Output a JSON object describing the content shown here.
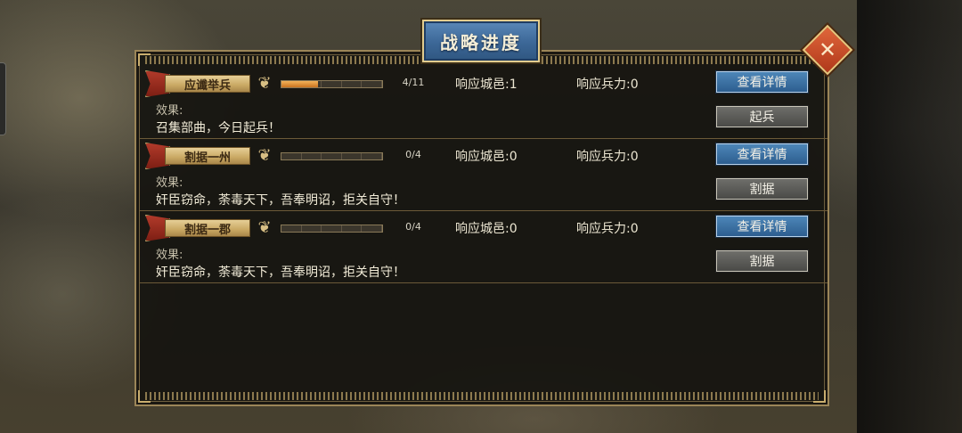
{
  "dialog": {
    "title": "战略进度",
    "close_label": "✕"
  },
  "rows": [
    {
      "name": "应谶举兵",
      "progress_current": 4,
      "progress_total": 11,
      "progress_text": "4/11",
      "cities": "响应城邑:1",
      "troops": "响应兵力:0",
      "effect_label": "效果:",
      "effect_text": "召集部曲，今日起兵！",
      "detail_label": "查看详情",
      "action_label": "起兵"
    },
    {
      "name": "割据一州",
      "progress_current": 0,
      "progress_total": 4,
      "progress_text": "0/4",
      "cities": "响应城邑:0",
      "troops": "响应兵力:0",
      "effect_label": "效果:",
      "effect_text": "奸臣窃命，荼毒天下，吾奉明诏，拒关自守！",
      "detail_label": "查看详情",
      "action_label": "割据"
    },
    {
      "name": "割据一郡",
      "progress_current": 0,
      "progress_total": 4,
      "progress_text": "0/4",
      "cities": "响应城邑:0",
      "troops": "响应兵力:0",
      "effect_label": "效果:",
      "effect_text": "奸臣窃命，荼毒天下，吾奉明诏，拒关自守！",
      "detail_label": "查看详情",
      "action_label": "割据"
    }
  ],
  "colors": {
    "accent_blue": "#3c6797",
    "progress_orange": "#e39a3f",
    "frame_gold": "#9c8658",
    "close_red": "#c8482a"
  }
}
